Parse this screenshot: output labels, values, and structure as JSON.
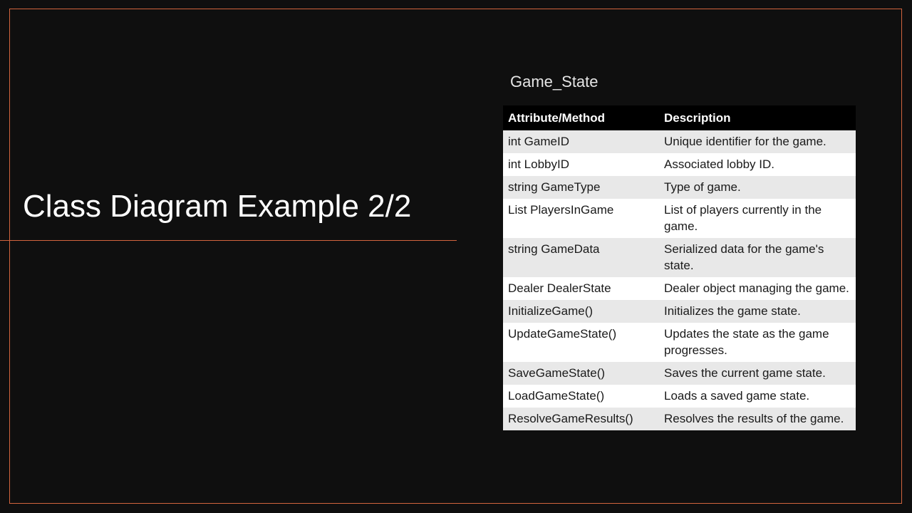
{
  "slide": {
    "title": "Class Diagram Example 2/2",
    "colors": {
      "background": "#0f0f0f",
      "accent": "#d2643e",
      "header_bg": "#000000",
      "row_shade": "#e8e8e8",
      "row_plain": "#ffffff"
    }
  },
  "table": {
    "caption": "Game_State",
    "headers": [
      "Attribute/Method",
      "Description"
    ],
    "rows": [
      [
        "int GameID",
        "Unique identifier for the game."
      ],
      [
        "int LobbyID",
        "Associated lobby ID."
      ],
      [
        "string GameType",
        "Type of game."
      ],
      [
        "List PlayersInGame",
        "List of players currently in the game."
      ],
      [
        "string GameData",
        "Serialized data for the game's state."
      ],
      [
        "Dealer DealerState",
        "Dealer object managing the game."
      ],
      [
        "InitializeGame()",
        "Initializes the game state."
      ],
      [
        "UpdateGameState()",
        "Updates the state as the game progresses."
      ],
      [
        "SaveGameState()",
        "Saves the current game state."
      ],
      [
        "LoadGameState()",
        "Loads a saved game state."
      ],
      [
        "ResolveGameResults()",
        "Resolves the results of the game."
      ]
    ]
  }
}
